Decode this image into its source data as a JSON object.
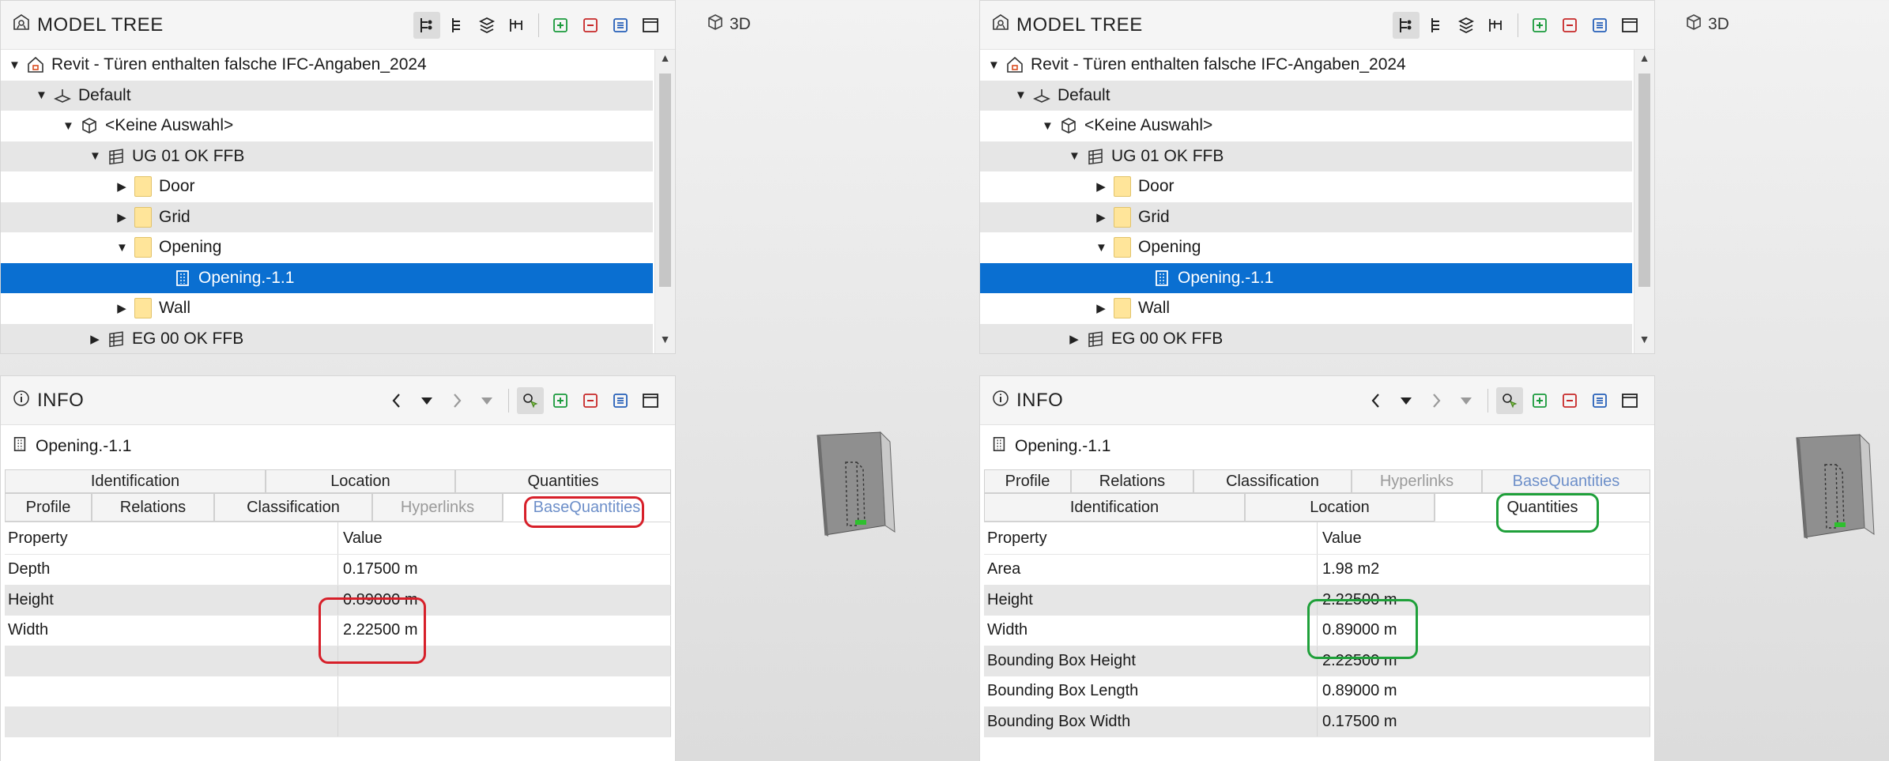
{
  "left": {
    "tree": {
      "title": "MODEL TREE",
      "rows": [
        {
          "label": "Revit - Türen enthalten falsche IFC-Angaben_2024",
          "caret": "▼"
        },
        {
          "label": "Default",
          "caret": "▼"
        },
        {
          "label": "<Keine Auswahl>",
          "caret": "▼"
        },
        {
          "label": "UG 01 OK FFB",
          "caret": "▼"
        },
        {
          "label": "Door",
          "caret": "▶"
        },
        {
          "label": "Grid",
          "caret": "▶"
        },
        {
          "label": "Opening",
          "caret": "▼"
        },
        {
          "label": "Opening.-1.1",
          "caret": ""
        },
        {
          "label": "Wall",
          "caret": "▶"
        },
        {
          "label": "EG 00 OK FFB",
          "caret": "▶"
        }
      ]
    },
    "info": {
      "title": "INFO",
      "object": "Opening.-1.1",
      "tabs_top": [
        "Identification",
        "Location",
        "Quantities"
      ],
      "tabs_bottom": [
        "Profile",
        "Relations",
        "Classification",
        "Hyperlinks",
        "BaseQuantities"
      ],
      "header": {
        "property": "Property",
        "value": "Value"
      },
      "rows": [
        {
          "property": "Depth",
          "value": "0.17500 m"
        },
        {
          "property": "Height",
          "value": "0.89000 m"
        },
        {
          "property": "Width",
          "value": "2.22500 m"
        },
        {
          "property": "",
          "value": ""
        },
        {
          "property": "",
          "value": ""
        },
        {
          "property": "",
          "value": ""
        }
      ]
    },
    "view3d": "3D"
  },
  "right": {
    "tree": {
      "title": "MODEL TREE",
      "rows": [
        {
          "label": "Revit - Türen enthalten falsche IFC-Angaben_2024",
          "caret": "▼"
        },
        {
          "label": "Default",
          "caret": "▼"
        },
        {
          "label": "<Keine Auswahl>",
          "caret": "▼"
        },
        {
          "label": "UG 01 OK FFB",
          "caret": "▼"
        },
        {
          "label": "Door",
          "caret": "▶"
        },
        {
          "label": "Grid",
          "caret": "▶"
        },
        {
          "label": "Opening",
          "caret": "▼"
        },
        {
          "label": "Opening.-1.1",
          "caret": ""
        },
        {
          "label": "Wall",
          "caret": "▶"
        },
        {
          "label": "EG 00 OK FFB",
          "caret": "▶"
        }
      ]
    },
    "info": {
      "title": "INFO",
      "object": "Opening.-1.1",
      "tabs_top": [
        "Profile",
        "Relations",
        "Classification",
        "Hyperlinks",
        "BaseQuantities"
      ],
      "tabs_bottom": [
        "Identification",
        "Location",
        "Quantities"
      ],
      "header": {
        "property": "Property",
        "value": "Value"
      },
      "rows": [
        {
          "property": "Area",
          "value": "1.98 m2"
        },
        {
          "property": "Height",
          "value": "2.22500 m"
        },
        {
          "property": "Width",
          "value": "0.89000 m"
        },
        {
          "property": "Bounding Box Height",
          "value": "2.22500 m"
        },
        {
          "property": "Bounding Box Length",
          "value": "0.89000 m"
        },
        {
          "property": "Bounding Box Width",
          "value": "0.17500 m"
        }
      ]
    },
    "view3d": "3D"
  },
  "colors": {
    "selection": "#0a6fd1",
    "highlight_wrong": "#d7202a",
    "highlight_right": "#1fa03a",
    "folder": "#ffe59a"
  }
}
